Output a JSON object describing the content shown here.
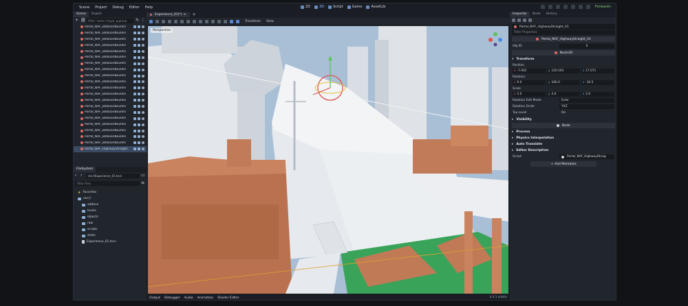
{
  "menu": [
    "Scene",
    "Project",
    "Debug",
    "Editor",
    "Help"
  ],
  "workspaces": [
    {
      "label": "2D",
      "active": false
    },
    {
      "label": "3D",
      "active": true
    },
    {
      "label": "Script",
      "active": false
    },
    {
      "label": "Game",
      "active": false
    },
    {
      "label": "AssetLib",
      "active": false
    }
  ],
  "renderer": "Forward+",
  "left_dock": {
    "tabs": [
      "Scene",
      "Import"
    ],
    "filter_placeholder": "Filter: name, t:type, g:group",
    "scene_rows": [
      "Portal_NAF_BillboardBuildin",
      "Portal_NAF_BillboardBuildin",
      "Portal_NAF_BillboardBuildin",
      "Portal_NAF_BillboardBuildin",
      "Portal_NAF_BillboardBuildin",
      "Portal_NAF_BillboardBuildin",
      "Portal_NAF_BillboardBuildin",
      "Portal_NAF_BillboardBuildin",
      "Portal_NAF_BillboardBuildin",
      "Portal_NAF_BillboardBuildin",
      "Portal_NAF_BillboardBuildin",
      "Portal_NAF_BillboardBuildin",
      "Portal_NAF_BillboardBuildin",
      "Portal_NAF_BillboardBuildin",
      "Portal_NAF_BillboardBuildin",
      "Portal_NAF_BillboardBuildin",
      "Portal_NAF_BillboardBuildin",
      "Portal_NAF_BillboardBuildin",
      "Portal_NAF_BillboardBuildin",
      "Portal_NAF_BillboardBuildin",
      "Portal_NAF_HighwayStraight"
    ],
    "filesystem": {
      "title": "FileSystem",
      "path": "res://Experience_01.tscn",
      "filter_placeholder": "Filter Files",
      "items": [
        {
          "label": "Favorites",
          "kind": "star",
          "indent": 1
        },
        {
          "label": "res://",
          "kind": "folder",
          "indent": 1
        },
        {
          "label": "addons",
          "kind": "folder",
          "indent": 2
        },
        {
          "label": "levels",
          "kind": "folder",
          "indent": 2
        },
        {
          "label": "objects",
          "kind": "folder",
          "indent": 2
        },
        {
          "label": "raw",
          "kind": "folder",
          "indent": 2
        },
        {
          "label": "scripts",
          "kind": "folder",
          "indent": 2
        },
        {
          "label": "static",
          "kind": "folder",
          "indent": 2
        },
        {
          "label": "Experience_01.tscn",
          "kind": "file",
          "indent": 2
        }
      ]
    }
  },
  "center": {
    "scene_tab": "Experience_01(*)",
    "toolbar_menus": [
      "Transform",
      "View"
    ],
    "perspective_label": "Perspective",
    "bottom_tabs": [
      "Output",
      "Debugger",
      "Audio",
      "Animation",
      "Shader Editor"
    ],
    "version": "4.4.1.stable"
  },
  "inspector": {
    "tabs": [
      "Inspector",
      "Node",
      "History"
    ],
    "node_path": "Portal_NAF_HighwayStraight_01",
    "filter_placeholder": "Filter Properties",
    "node_title": "Portal_NAF_HighwayStraight_01",
    "obj_id_label": "Obj ID",
    "obj_id_value": "0",
    "class_name": "Node3D",
    "transform_label": "Transform",
    "position_label": "Position",
    "position": [
      "-7.932",
      "120.163",
      "17.071"
    ],
    "rotation_label": "Rotation",
    "rotation": [
      "0.0",
      "180.0",
      "-34.5"
    ],
    "scale_label": "Scale",
    "scale": [
      "2.0",
      "2.0",
      "2.0"
    ],
    "rotation_edit_mode_label": "Rotation Edit Mode",
    "rotation_edit_mode": "Euler",
    "rotation_order_label": "Rotation Order",
    "rotation_order": "YXZ",
    "top_level_label": "Top Level",
    "top_level_value": "On",
    "visibility_label": "Visibility",
    "node_section": "Node",
    "process_label": "Process",
    "physics_label": "Physics Interpolation",
    "auto_translate_label": "Auto Translate",
    "editor_desc_label": "Editor Description",
    "script_label": "Script",
    "script_value": "Portal_NAF_HighwayStraig",
    "add_metadata": "Add Metadata"
  },
  "colors": {
    "accent": "#5a86d6",
    "node3d": "#e06c6c",
    "sky": "#a9bfd6",
    "building_orange": "#c07a55",
    "building_white": "#e9ecef",
    "grass": "#3aa35a"
  }
}
